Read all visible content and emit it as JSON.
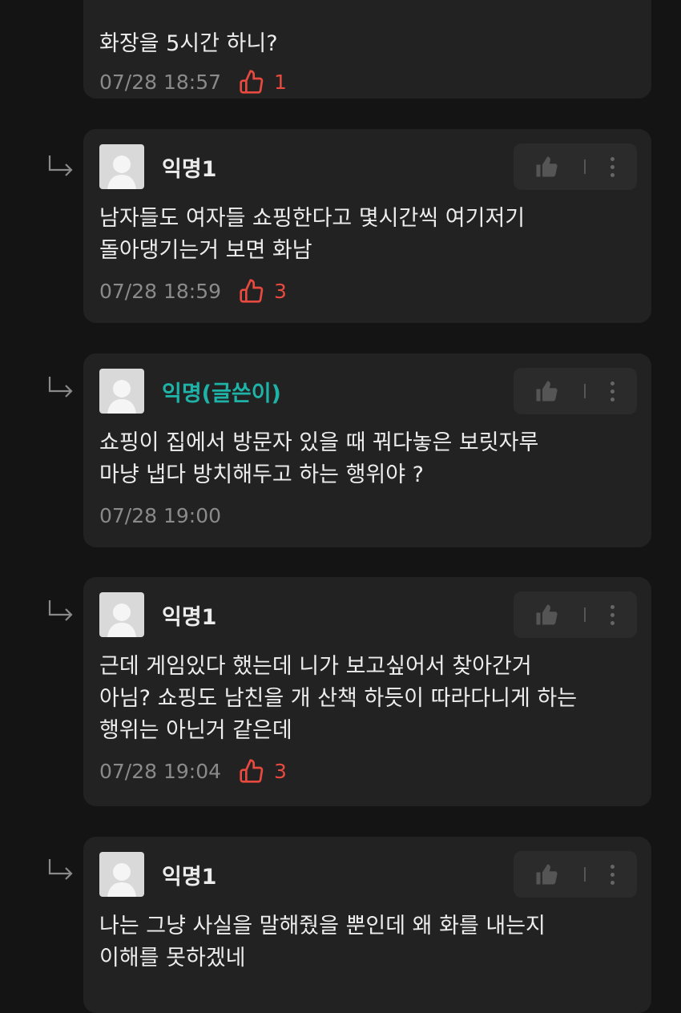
{
  "comments": [
    {
      "top_partial_text": "화장을 5시간 하니?",
      "time": "07/28 18:57",
      "likes": "1"
    },
    {
      "author": "익명1",
      "text": "남자들도 여자들 쇼핑한다고 몇시간씩 여기저기\n돌아댕기는거 보면 화남",
      "time": "07/28 18:59",
      "likes": "3"
    },
    {
      "author": "익명(글쓴이)",
      "text": "쇼핑이 집에서 방문자 있을 때 꿔다놓은 보릿자루\n마냥 냅다 방치해두고 하는 행위야 ?",
      "time": "07/28 19:00"
    },
    {
      "author": "익명1",
      "text": "근데 게임있다 했는데 니가 보고싶어서 찾아간거\n아님? 쇼핑도 남친을 개 산책 하듯이 따라다니게 하는\n행위는 아닌거 같은데",
      "time": "07/28 19:04",
      "likes": "3"
    },
    {
      "author": "익명1",
      "text": "나는 그냥 사실을 말해줬을 뿐인데 왜 화를 내는지\n이해를 못하겠네"
    }
  ],
  "colors": {
    "accent_op": "#1fb3a8",
    "like": "#e84a3f"
  }
}
